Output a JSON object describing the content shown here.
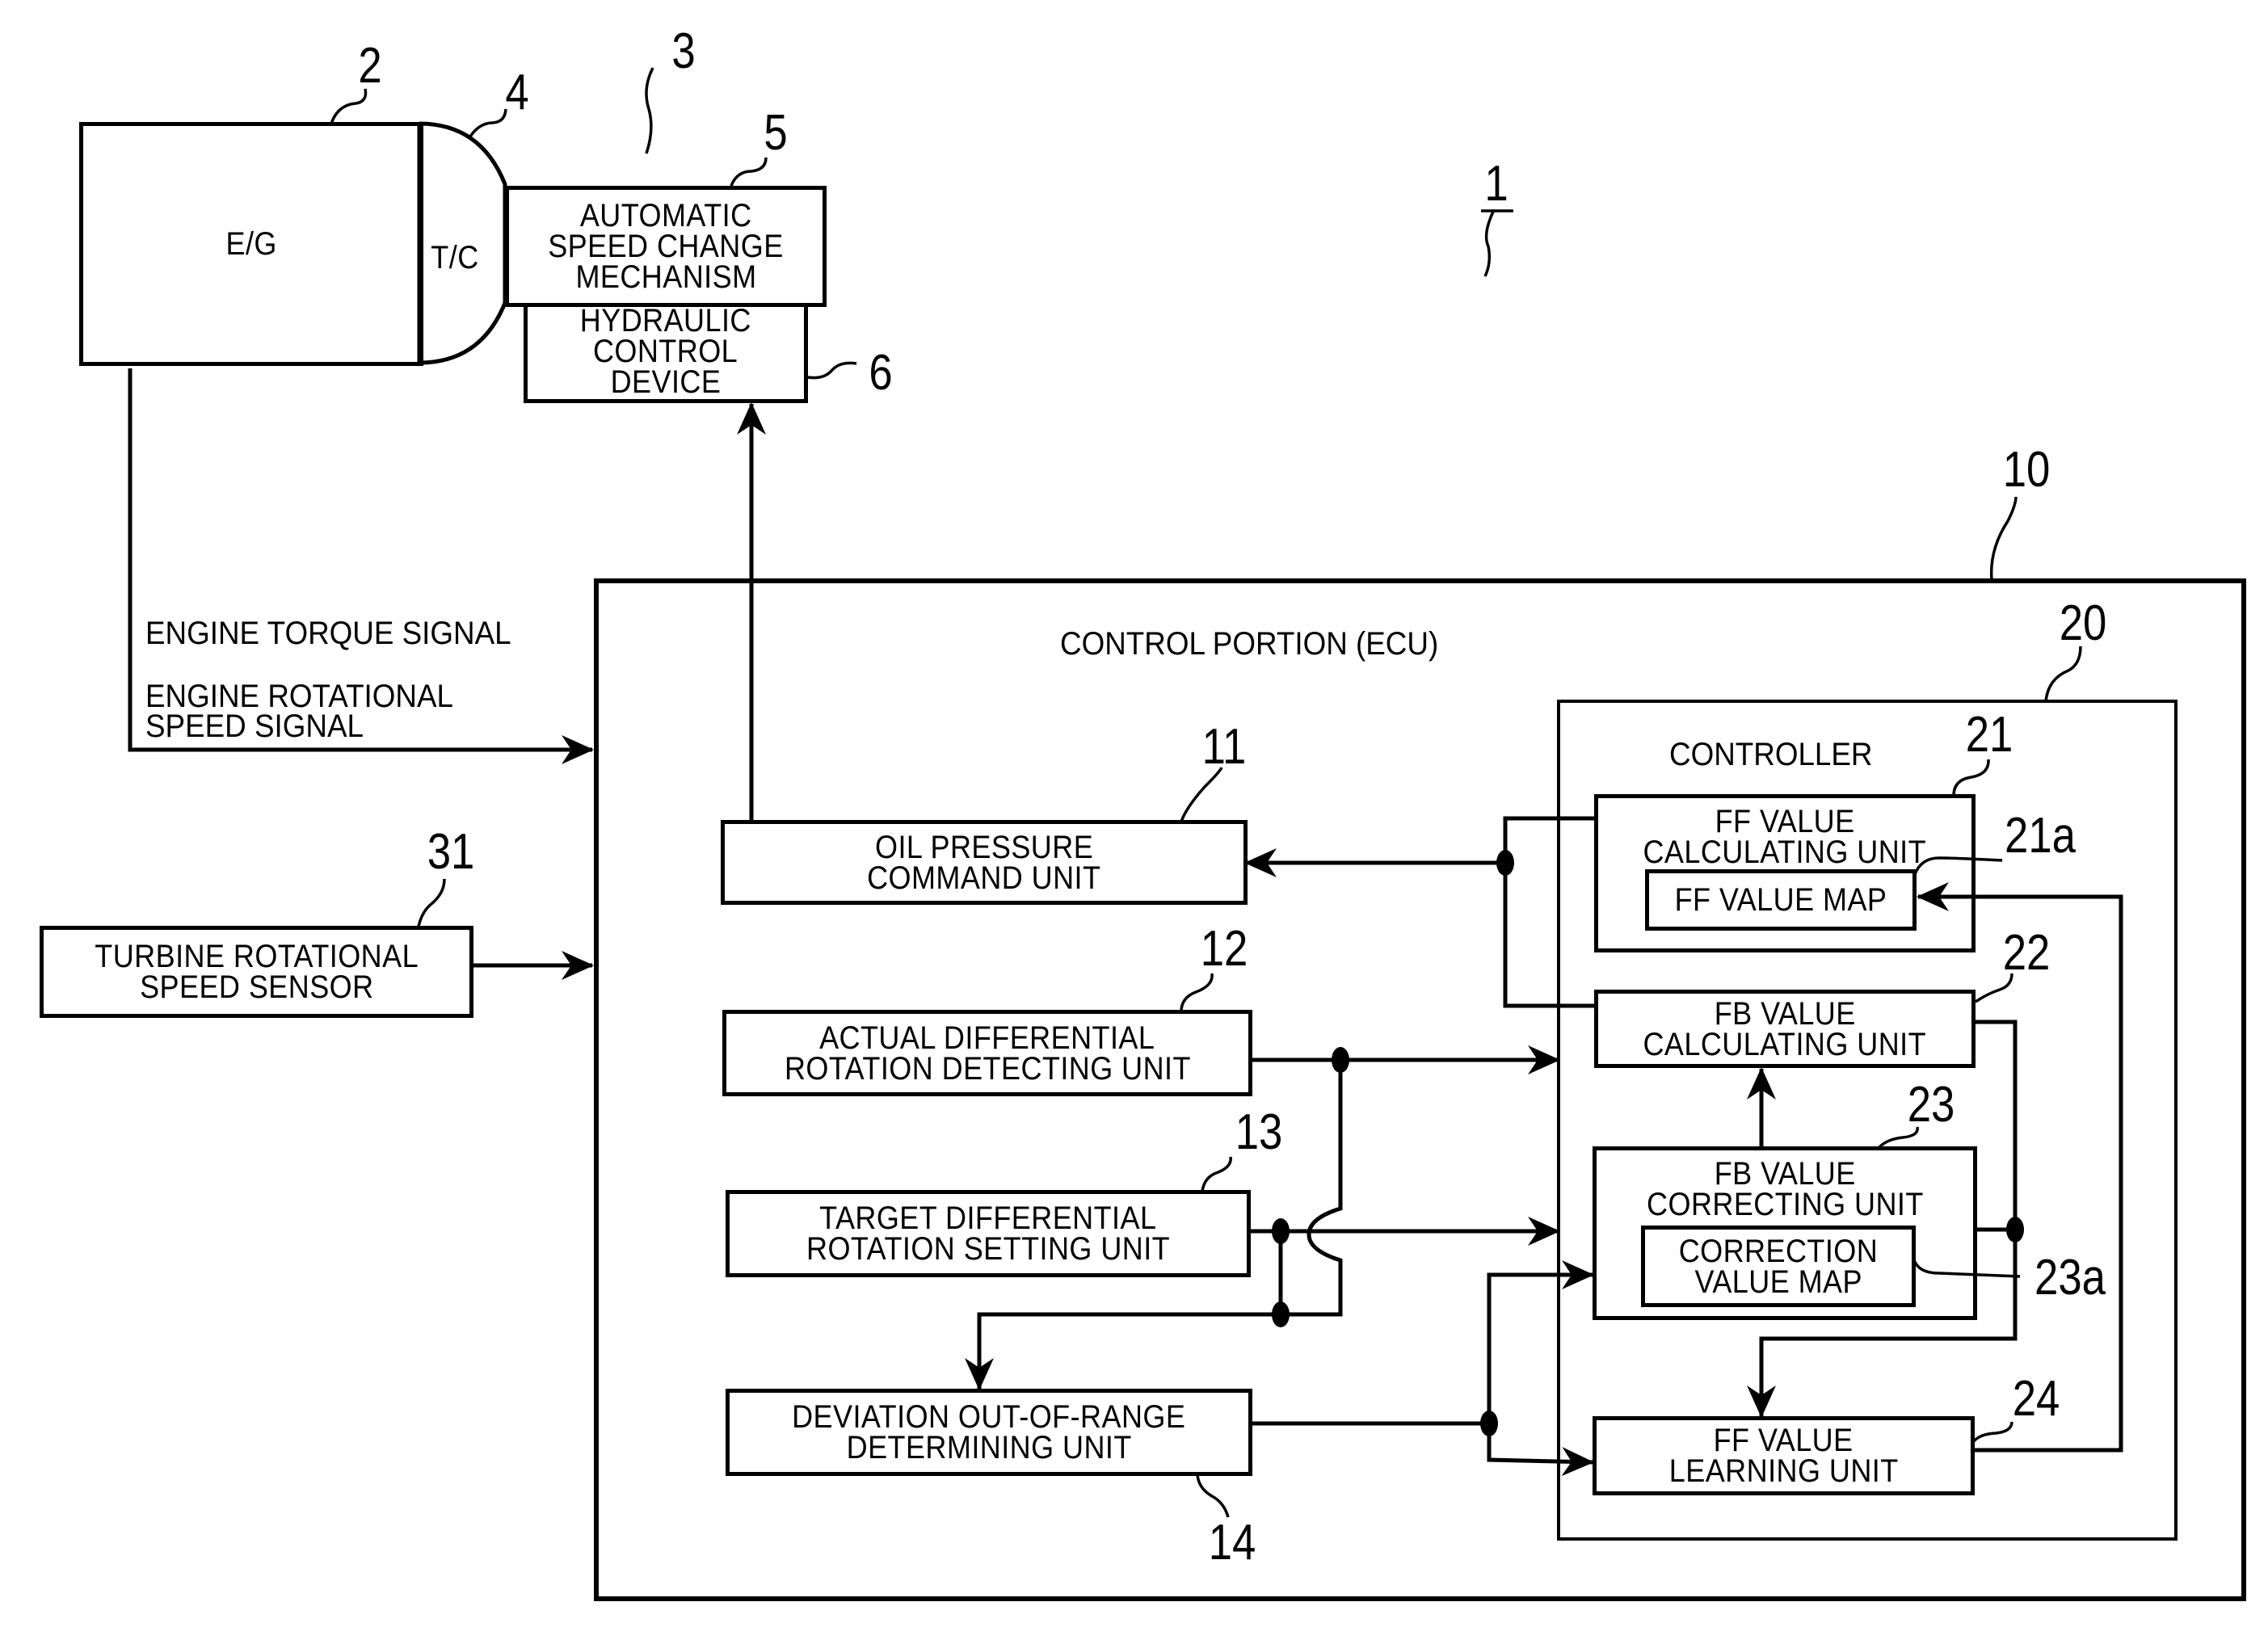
{
  "figure": {
    "system_ref": "1",
    "engine": {
      "ref": "2",
      "label": "E/G"
    },
    "transmission": {
      "ref": "3"
    },
    "torque_converter": {
      "ref": "4",
      "label": "T/C"
    },
    "speed_change_mechanism": {
      "ref": "5",
      "lines": [
        "AUTOMATIC",
        "SPEED CHANGE",
        "MECHANISM"
      ]
    },
    "hydraulic_control_device": {
      "ref": "6",
      "lines": [
        "HYDRAULIC",
        "CONTROL",
        "DEVICE"
      ]
    },
    "signals": {
      "engine_torque": "ENGINE TORQUE SIGNAL",
      "engine_speed": [
        "ENGINE ROTATIONAL",
        "SPEED SIGNAL"
      ]
    },
    "turbine_sensor": {
      "ref": "31",
      "lines": [
        "TURBINE ROTATIONAL",
        "SPEED SENSOR"
      ]
    },
    "ecu": {
      "ref": "10",
      "title": "CONTROL PORTION (ECU)",
      "units": [
        {
          "ref": "11",
          "lines": [
            "OIL PRESSURE",
            "COMMAND UNIT"
          ]
        },
        {
          "ref": "12",
          "lines": [
            "ACTUAL DIFFERENTIAL",
            "ROTATION DETECTING UNIT"
          ]
        },
        {
          "ref": "13",
          "lines": [
            "TARGET DIFFERENTIAL",
            "ROTATION SETTING UNIT"
          ]
        },
        {
          "ref": "14",
          "lines": [
            "DEVIATION OUT-OF-RANGE",
            "DETERMINING UNIT"
          ]
        }
      ],
      "controller": {
        "ref": "20",
        "title": "CONTROLLER",
        "ff_calc": {
          "ref": "21",
          "lines": [
            "FF VALUE",
            "CALCULATING UNIT"
          ]
        },
        "ff_map": {
          "ref": "21a",
          "label": "FF VALUE MAP"
        },
        "fb_calc": {
          "ref": "22",
          "lines": [
            "FB VALUE",
            "CALCULATING UNIT"
          ]
        },
        "fb_correct": {
          "ref": "23",
          "lines": [
            "FB VALUE",
            "CORRECTING UNIT"
          ]
        },
        "correction_map": {
          "ref": "23a",
          "lines": [
            "CORRECTION",
            "VALUE MAP"
          ]
        },
        "ff_learning": {
          "ref": "24",
          "lines": [
            "FF VALUE",
            "LEARNING UNIT"
          ]
        }
      }
    }
  }
}
